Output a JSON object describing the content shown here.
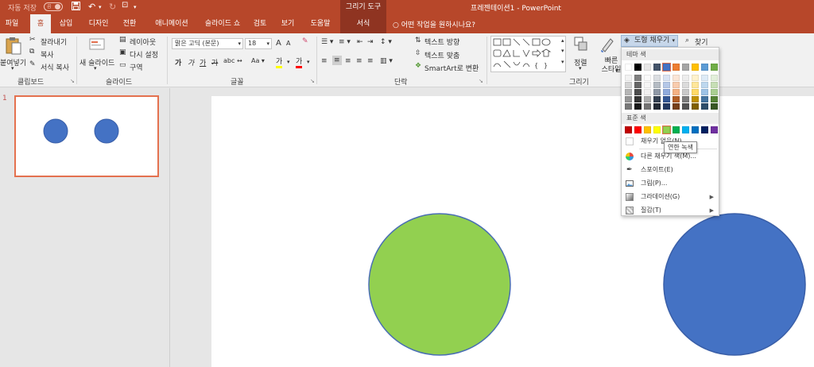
{
  "titlebar": {
    "autosave": "자동 저장",
    "autosave_state": "끔",
    "context_tool": "그리기 도구",
    "doc_title": "프레젠테이션1  -  PowerPoint"
  },
  "tabs": [
    "파일",
    "홈",
    "삽입",
    "디자인",
    "전환",
    "애니메이션",
    "슬라이드 쇼",
    "검토",
    "보기",
    "도움말",
    "서식"
  ],
  "tellme": "어떤 작업을 원하시나요?",
  "ribbon": {
    "clipboard": {
      "paste": "붙여넣기",
      "cut": "잘라내기",
      "copy": "복사",
      "format_painter": "서식 복사",
      "label": "클립보드"
    },
    "slides": {
      "new_slide": "새 슬라이드",
      "layout": "레이아웃",
      "reset": "다시 설정",
      "section": "구역",
      "label": "슬라이드"
    },
    "font": {
      "font_name": "맑은 고딕 (본문)",
      "font_size": "18",
      "bold": "가",
      "italic": "가",
      "underline": "가",
      "strike": "가",
      "label": "글꼴"
    },
    "paragraph": {
      "text_direction": "텍스트 방향",
      "align_text": "텍스트 맞춤",
      "smartart": "SmartArt로 변환",
      "label": "단락"
    },
    "drawing": {
      "arrange": "정렬",
      "quick_styles": "빠른 스타일",
      "shape_fill": "도형 채우기",
      "label": "그리기"
    },
    "editing": {
      "find": "찾기"
    }
  },
  "thumbnail": {
    "slide_number": "1"
  },
  "dropdown": {
    "theme_colors_header": "테마 색",
    "standard_colors_header": "표준 색",
    "no_fill": "채우기 없음(N)",
    "more_colors": "다른 채우기 색(M)...",
    "eyedropper": "스포이트(E)",
    "picture": "그림(P)...",
    "gradient": "그라데이션(G)",
    "texture": "질감(T)",
    "tooltip": "연한 녹색"
  },
  "colors": {
    "title_bar": "#b7472a",
    "context_tab": "#8f3421",
    "shape_blue": "#4472c4",
    "shape_green": "#92d050",
    "thumb_border": "#e4714f",
    "theme_top_row": [
      "#ffffff",
      "#000000",
      "#e7e6e6",
      "#44546a",
      "#4472c4",
      "#ed7d31",
      "#a5a5a5",
      "#ffc000",
      "#5b9bd5",
      "#70ad47"
    ],
    "standard_row": [
      "#c00000",
      "#ff0000",
      "#ffc000",
      "#ffff00",
      "#92d050",
      "#00b050",
      "#00b0f0",
      "#0070c0",
      "#002060",
      "#7030a0"
    ]
  }
}
